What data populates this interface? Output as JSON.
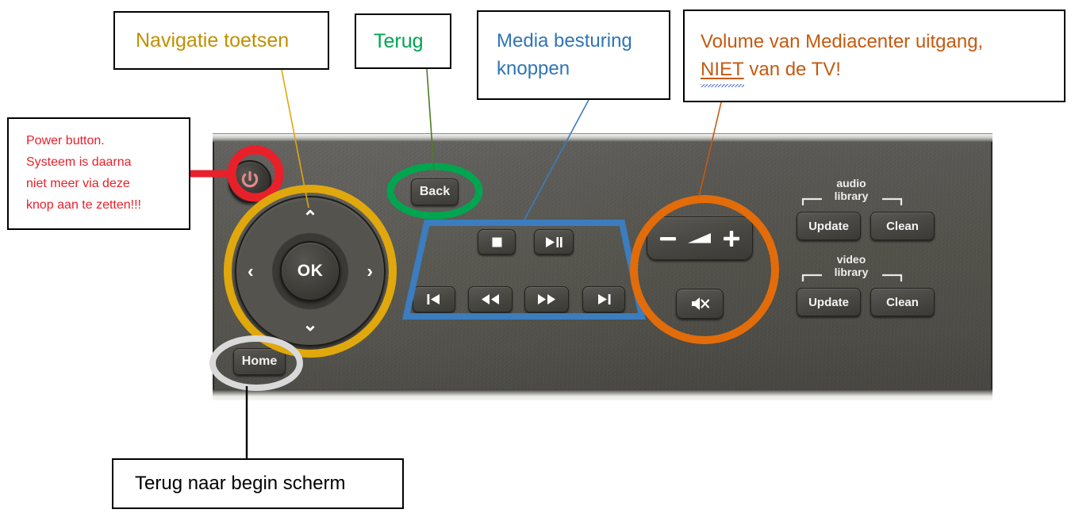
{
  "colors": {
    "gold": "#E0A80D",
    "green": "#00A550",
    "blue": "#3B7DBF",
    "orange": "#E36C0A",
    "red": "#E8202A",
    "grey": "#D9D9D9",
    "black": "#000000",
    "text_gold": "#BF9000",
    "text_green": "#00A550",
    "text_blue": "#2E75B6",
    "text_orange": "#C55A11",
    "text_red": "#E8202A"
  },
  "callouts": {
    "navigation": {
      "label": "Navigatie toetsen"
    },
    "back": {
      "label": "Terug"
    },
    "media": {
      "line1": "Media besturing",
      "line2": "knoppen"
    },
    "volume": {
      "line1": "Volume van Mediacenter uitgang,",
      "line2_emph": "NIET",
      "line2_rest": " van de TV!"
    },
    "power": {
      "line1": "Power button.",
      "line2": "Systeem is daarna",
      "line3": "niet meer via deze",
      "line4": "knop aan te zetten!!!"
    },
    "home": {
      "label": "Terug naar begin scherm"
    }
  },
  "remote": {
    "power_button": {
      "icon": "power-icon"
    },
    "dpad": {
      "ok_label": "OK",
      "up": "⌃",
      "down": "⌄",
      "left": "‹",
      "right": "›"
    },
    "home_button": {
      "label": "Home"
    },
    "back_button": {
      "label": "Back"
    },
    "media_buttons": [
      {
        "name": "stop",
        "icon": "stop-icon"
      },
      {
        "name": "play-pause",
        "icon": "play-pause-icon"
      },
      {
        "name": "previous-track",
        "icon": "previous-track-icon"
      },
      {
        "name": "rewind",
        "icon": "rewind-icon"
      },
      {
        "name": "fast-forward",
        "icon": "fast-forward-icon"
      },
      {
        "name": "next-track",
        "icon": "next-track-icon"
      }
    ],
    "volume": {
      "minus": "−",
      "speaker_icon": "speaker-wedge-icon",
      "plus": "+",
      "mute_icon": "mute-icon"
    },
    "audio_library": {
      "title_line1": "audio",
      "title_line2": "library",
      "update_label": "Update",
      "clean_label": "Clean"
    },
    "video_library": {
      "title_line1": "video",
      "title_line2": "library",
      "update_label": "Update",
      "clean_label": "Clean"
    }
  }
}
